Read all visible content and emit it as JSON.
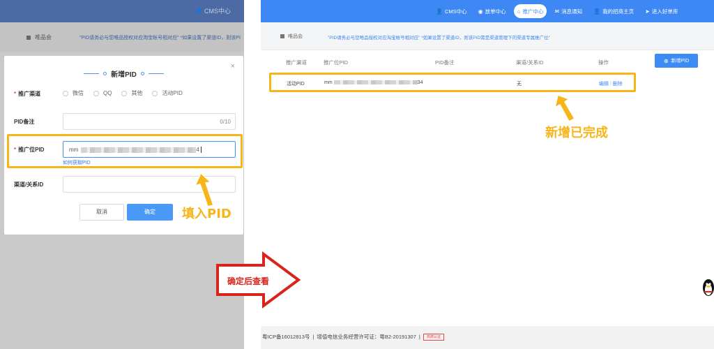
{
  "colors": {
    "primary_blue": "#3d88f4",
    "highlight_yellow": "#f6b519",
    "arrow_red": "#d9241c",
    "required_red": "#e24a4a"
  },
  "left": {
    "topbar": {
      "cms_label": "CMS中心",
      "cms_icon": "user-icon"
    },
    "tab": {
      "label": "唯品会",
      "icon": "grid-icon"
    },
    "notice": "\"PID请务必与您唯品授权对应淘宝帐号相对应\" *如果设置了渠道ID，则该PI",
    "modal": {
      "title": "新增PID",
      "close": "×",
      "fields": {
        "channel": {
          "label": "推广渠道",
          "required": "*",
          "options": [
            "微信",
            "QQ",
            "其他",
            "活动PID"
          ]
        },
        "remark": {
          "label": "PID备注",
          "counter": "0/10"
        },
        "pid": {
          "label": "推广位PID",
          "required": "*",
          "value_prefix": "mm",
          "value_suffix": "4",
          "help_link": "如何获取PID"
        },
        "relation": {
          "label": "渠道/关系ID"
        }
      },
      "cancel_label": "取消",
      "confirm_label": "确定"
    },
    "annotation": "填入PID"
  },
  "arrow_label": "确定后查看",
  "right": {
    "nav": [
      {
        "label": "CMS中心",
        "icon": "user-icon",
        "active": false
      },
      {
        "label": "放单中心",
        "icon": "coin-icon",
        "active": false
      },
      {
        "label": "推广中心",
        "icon": "home-icon",
        "active": true
      },
      {
        "label": "消息通知",
        "icon": "mail-icon",
        "active": false
      },
      {
        "label": "我的招商主页",
        "icon": "user-icon",
        "active": false
      },
      {
        "label": "进入好单库",
        "icon": "send-icon",
        "active": false
      }
    ],
    "tab": {
      "label": "唯品会",
      "icon": "grid-icon"
    },
    "notice": "\"PID请务必与您唯品授权对应淘宝帐号相对应\" *如果设置了渠道ID，则该PID需是渠道管理下的渠道专属推广位\"",
    "table": {
      "columns": [
        "推广渠道",
        "推广位PID",
        "PID备注",
        "渠道/关系ID",
        "操作"
      ],
      "new_button": "新增PID",
      "rows": [
        {
          "channel": "活动PID",
          "pid_prefix": "mm",
          "pid_suffix": "34",
          "remark": "",
          "relation": "无",
          "actions": [
            "编辑",
            "删除"
          ]
        }
      ]
    },
    "annotation": "新增已完成",
    "footer": {
      "icp": "粤ICP备16012813号",
      "license": "增值电信业务经营许可证：粤B2-20191307",
      "logo_text": "高德认证"
    }
  }
}
